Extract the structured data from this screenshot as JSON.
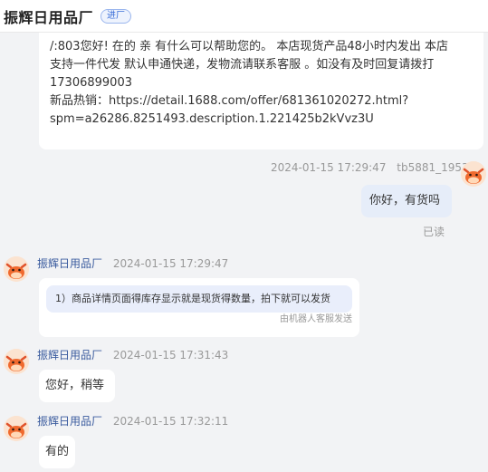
{
  "header": {
    "title": "振辉日用品厂",
    "enter_tag": "进厂"
  },
  "top_message": {
    "lines": [
      "/:803您好! 在的 亲 有什么可以帮助您的。 本店现货产品48小时内发出 本店",
      "支持一件代发 默认申通快递，发物流请联系客服 。如没有及时回复请拨打",
      "17306899003",
      "新品热销：https://detail.1688.com/offer/681361020272.html?",
      "spm=a26286.8251493.description.1.221425b2kVvz3U"
    ]
  },
  "my_message": {
    "timestamp": "2024-01-15 17:29:47",
    "sender": "tb5881_1953",
    "text": "你好，有货吗",
    "read_status": "已读"
  },
  "replies": [
    {
      "sender": "振辉日用品厂",
      "timestamp": "2024-01-15 17:29:47",
      "auto_text": "1）商品详情页面得库存显示就是现货得数量，拍下就可以发货",
      "auto_note": "由机器人客服发送"
    },
    {
      "sender": "振辉日用品厂",
      "timestamp": "2024-01-15 17:31:43",
      "text": "您好，稍等"
    },
    {
      "sender": "振辉日用品厂",
      "timestamp": "2024-01-15 17:32:11",
      "text": "有的"
    }
  ],
  "colors": {
    "background": "#f2f3f5",
    "bubble": "#ffffff",
    "my_bubble": "#e6edf9",
    "sender_name": "#3a5b9e",
    "meta_text": "#999999"
  }
}
